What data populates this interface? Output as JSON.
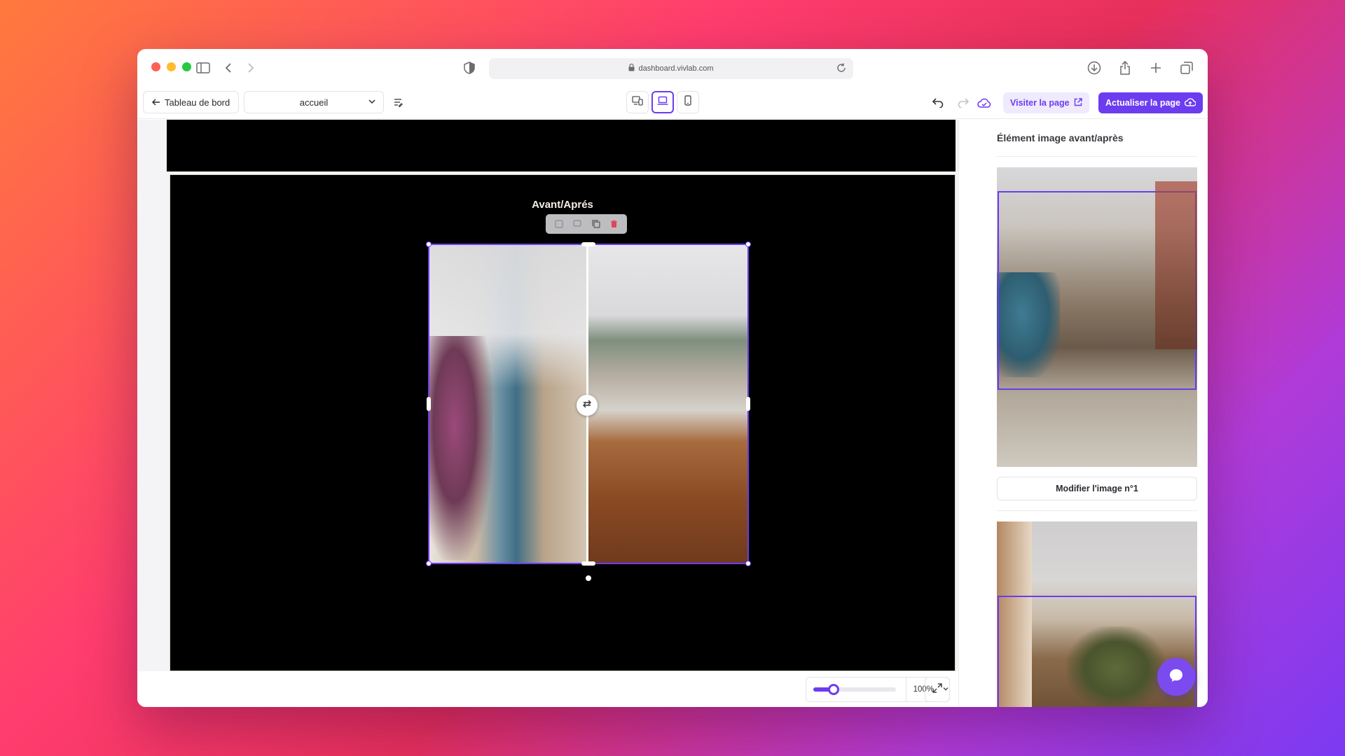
{
  "browser": {
    "url": "dashboard.vivlab.com"
  },
  "toolbar": {
    "back_label": "Tableau de bord",
    "page_select_value": "accueil",
    "visit_label": "Visiter la page",
    "update_label": "Actualiser la page"
  },
  "canvas": {
    "section_title": "Avant/Aprés"
  },
  "zoom": {
    "value_label": "100%",
    "level_fraction": 0.25
  },
  "panel": {
    "title": "Élément image avant/après",
    "modify_label": "Modifier l'image n°1"
  },
  "colors": {
    "accent": "#6c3cf0",
    "danger": "#e0445a"
  }
}
